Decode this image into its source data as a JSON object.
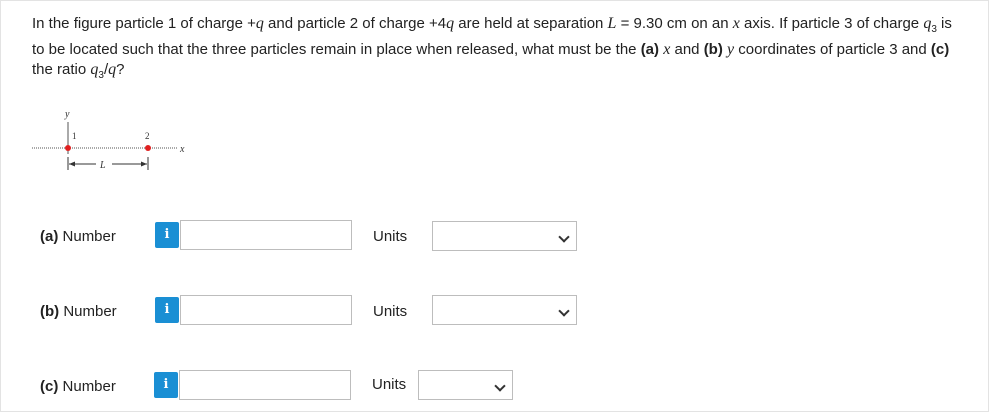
{
  "question": {
    "p1": "In the figure particle 1 of charge +",
    "q1": "q",
    "p2": " and particle 2 of charge +4",
    "q2": "q",
    "p3": " are held at separation ",
    "L": "L",
    "p4": " = 9.30 cm on an ",
    "x1": "x",
    "p5": " axis. If particle 3 of charge ",
    "q3": "q",
    "q3sub": "3",
    "p6": " is to be located such that the three particles remain in place when released, what must be the ",
    "a": "(a)",
    "p7": " ",
    "x2": "x",
    "p8": " and ",
    "b": "(b)",
    "p9": " ",
    "y1": "y",
    "p10": " coordinates of particle 3 and ",
    "c": "(c)",
    "p11": " the ratio ",
    "ratio_q3": "q",
    "ratio_sub": "3",
    "ratio_slash": "/",
    "ratio_q": "q",
    "p12": "?"
  },
  "figure": {
    "y_axis_label": "y",
    "x_axis_label": "x",
    "particle1_label": "1",
    "particle2_label": "2",
    "separation_label": "L",
    "particle_color": "#e02020"
  },
  "answers": [
    {
      "letter": "(a)",
      "label": "Number",
      "info": "i",
      "units_label": "Units",
      "value": "",
      "units_value": ""
    },
    {
      "letter": "(b)",
      "label": "Number",
      "info": "i",
      "units_label": "Units",
      "value": "",
      "units_value": ""
    },
    {
      "letter": "(c)",
      "label": "Number",
      "info": "i",
      "units_label": "Units",
      "value": "",
      "units_value": ""
    }
  ],
  "colors": {
    "info_button": "#1a8fd4",
    "input_border": "#bdbdbd"
  }
}
